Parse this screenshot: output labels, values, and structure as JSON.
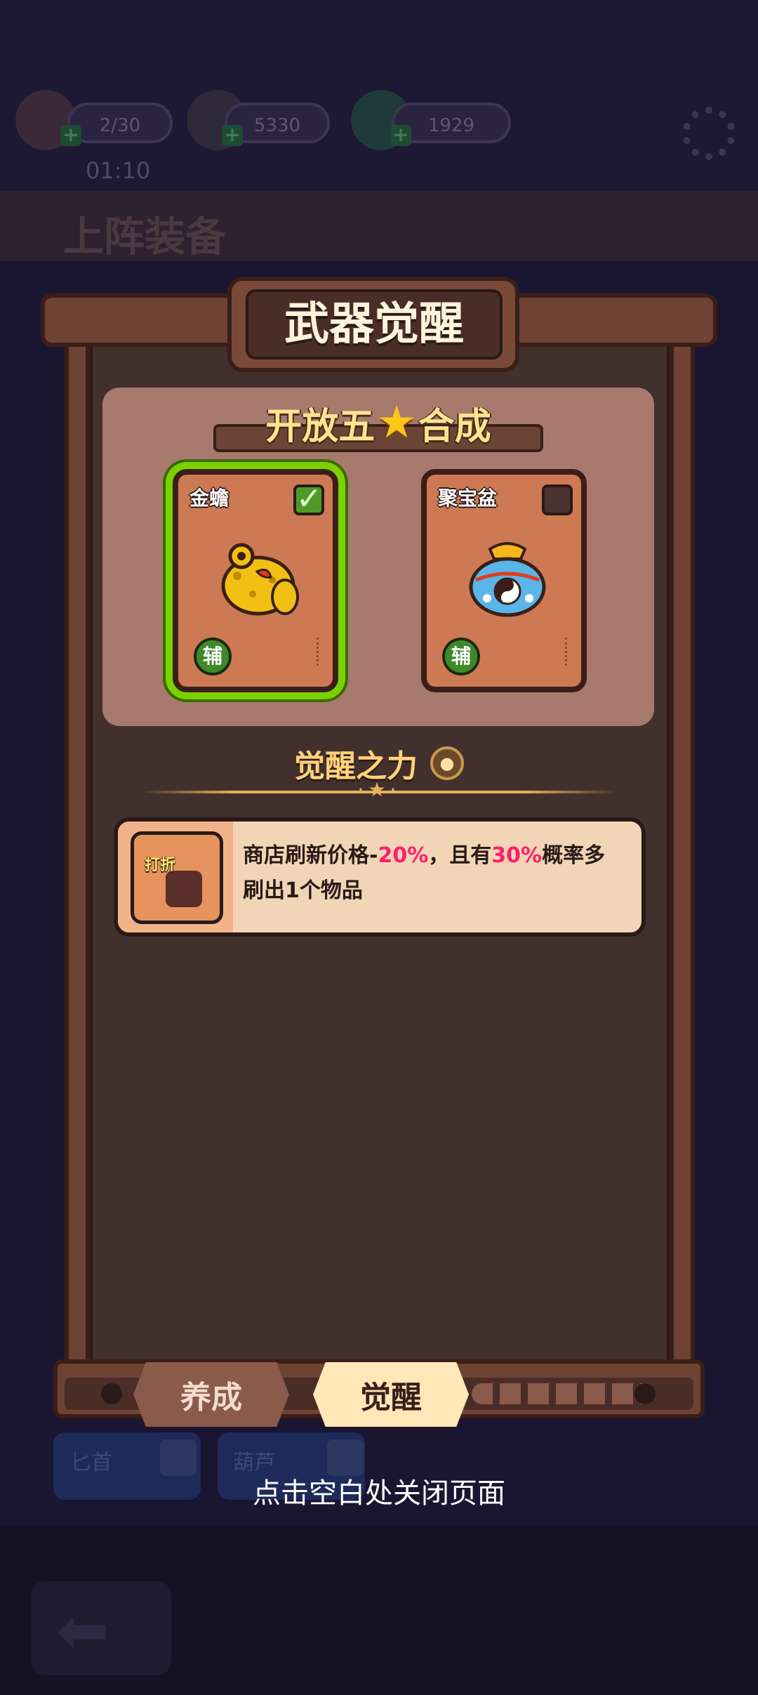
{
  "resources": [
    {
      "name": "stamina",
      "icon": "peach-icon",
      "value": "2/30"
    },
    {
      "name": "gold",
      "icon": "quill-icon",
      "value": "5330"
    },
    {
      "name": "gem",
      "icon": "pearl-icon",
      "value": "1929"
    }
  ],
  "timer": "01:10",
  "background_banner_title": "上阵装备",
  "background_slots": [
    {
      "label": "匕首"
    },
    {
      "label": "葫芦"
    }
  ],
  "modal": {
    "title": "武器觉醒",
    "synthesis": {
      "title_before_star": "开放五",
      "title_after_star": "合成",
      "star_icon": "star-icon",
      "cards": [
        {
          "name": "金蟾",
          "badge": "辅",
          "checked": true,
          "icon": "golden-toad-icon"
        },
        {
          "name": "聚宝盆",
          "badge": "辅",
          "checked": false,
          "icon": "treasure-bag-icon"
        }
      ]
    },
    "awaken_power": {
      "title": "觉醒之力",
      "icon_label": "打折",
      "description_parts": [
        "商店刷新价格-",
        "20%",
        "，且有",
        "30%",
        "概率多刷出1个物品"
      ]
    },
    "tabs": [
      {
        "label": "养成",
        "active": false
      },
      {
        "label": "觉醒",
        "active": true
      }
    ]
  },
  "close_hint": "点击空白处关闭页面",
  "colors": {
    "highlight": "#ff1f6a",
    "selected_glow": "#7bd000",
    "panel": "#42302d",
    "title_text": "#fff4dc"
  }
}
